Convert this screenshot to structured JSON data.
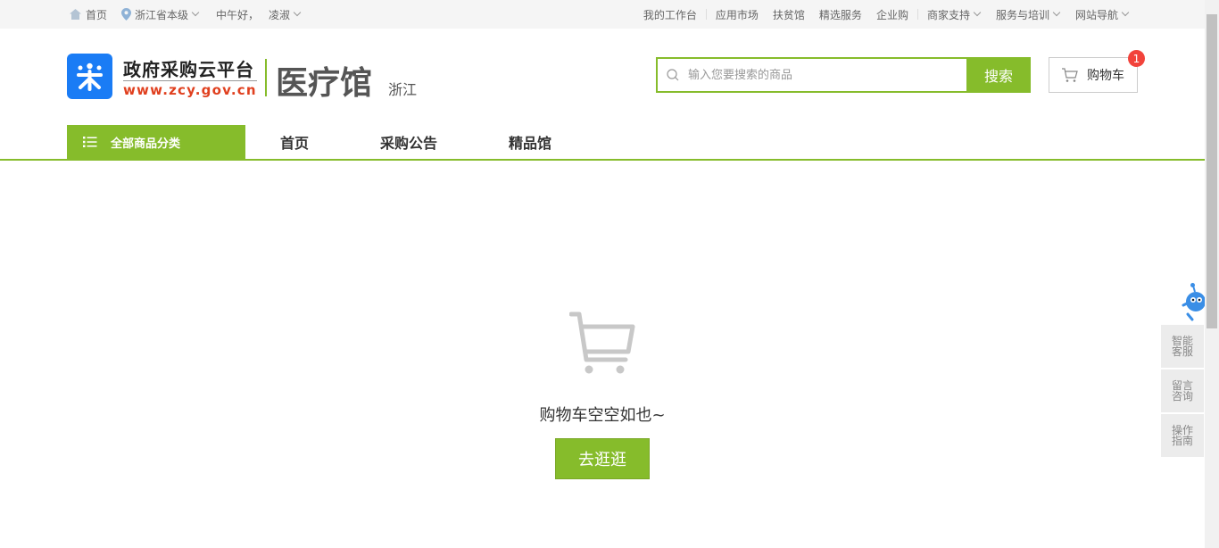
{
  "topbar": {
    "home": "首页",
    "location": "浙江省本级",
    "greeting": "中午好，",
    "username": "凌淑",
    "links": [
      "我的工作台",
      "应用市场",
      "扶贫馆",
      "精选服务",
      "企业购",
      "商家支持",
      "服务与培训",
      "网站导航"
    ]
  },
  "header": {
    "brand_title": "政府采购云平台",
    "brand_url": "www.zcy.gov.cn",
    "hall_title": "医疗馆",
    "hall_region": "浙江",
    "search_placeholder": "输入您要搜索的商品",
    "search_button": "搜索",
    "cart_label": "购物车",
    "cart_count": "1"
  },
  "nav": {
    "category_label": "全部商品分类",
    "links": [
      "首页",
      "采购公告",
      "精品馆"
    ]
  },
  "main": {
    "empty_text": "购物车空空如也~",
    "go_button": "去逛逛"
  },
  "float": {
    "items": [
      "智能客服",
      "留言咨询",
      "操作指南"
    ]
  },
  "colors": {
    "accent": "#86bc2b",
    "brand_blue": "#1a7cf5",
    "url_red": "#e0401f",
    "badge_red": "#f2433b"
  }
}
